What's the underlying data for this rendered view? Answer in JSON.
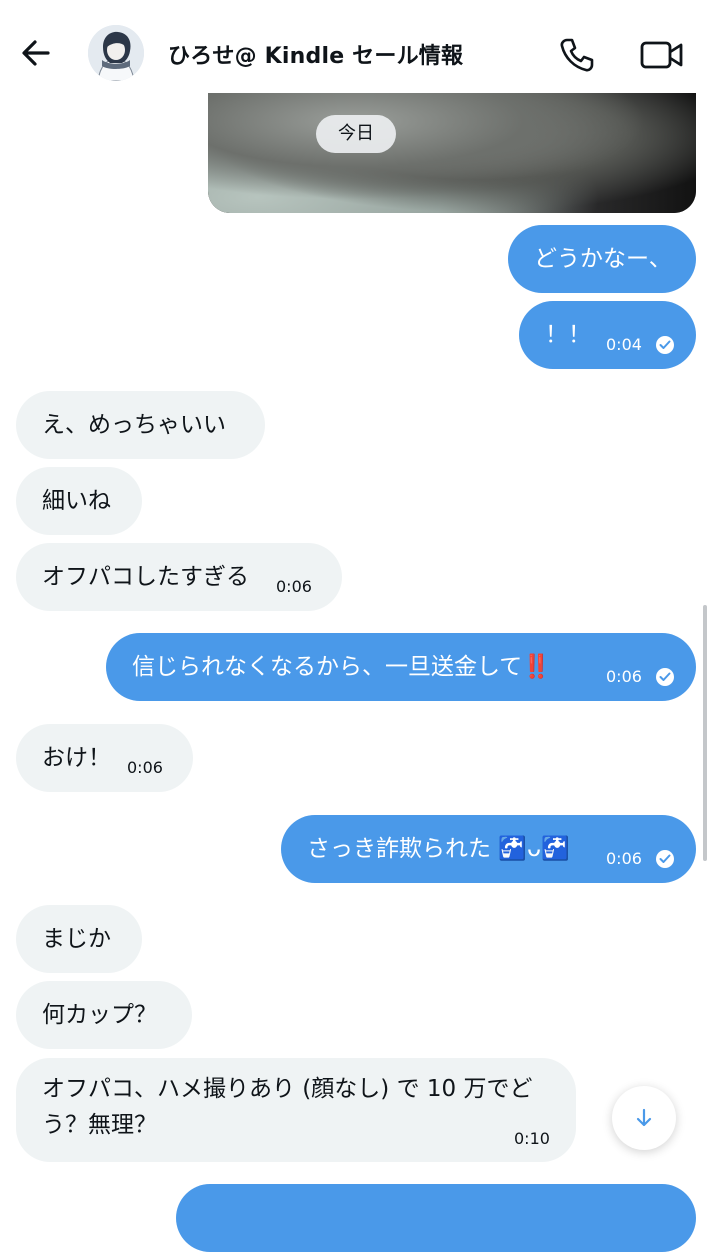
{
  "header": {
    "contact_name": "ひろせ@ Kindle セール情報",
    "back_icon": "arrow-left-icon",
    "call_icon": "phone-icon",
    "video_icon": "video-camera-icon"
  },
  "date_label": "今日",
  "messages": [
    {
      "dir": "out",
      "text": "どうかなー、",
      "time": ""
    },
    {
      "dir": "out",
      "text": "！！",
      "time": "0:04",
      "read": true
    },
    {
      "dir": "in",
      "text": "え、めっちゃいい",
      "time": ""
    },
    {
      "dir": "in",
      "text": "細いね",
      "time": ""
    },
    {
      "dir": "in",
      "text": "オフパコしたすぎる",
      "time": "0:06"
    },
    {
      "dir": "out",
      "text": "信じられなくなるから、一旦送金して‼️",
      "time": "0:06",
      "read": true
    },
    {
      "dir": "in",
      "text": "おけ！",
      "time": "0:06"
    },
    {
      "dir": "out",
      "text": "さっき詐欺られた 🚰ᴗ🚰",
      "time": "0:06",
      "read": true
    },
    {
      "dir": "in",
      "text": "まじか",
      "time": ""
    },
    {
      "dir": "in",
      "text": "何カップ？",
      "time": ""
    },
    {
      "dir": "in",
      "text_line1": "オフパコ、ハメ撮りあり (顔なし) で 10 万でど",
      "text_line2": "う？無理？",
      "time": "0:10"
    }
  ],
  "colors": {
    "outgoing": "#4a99e9",
    "incoming": "#eff3f4",
    "text": "#0f1419"
  },
  "scroll_down_icon": "arrow-down-icon"
}
